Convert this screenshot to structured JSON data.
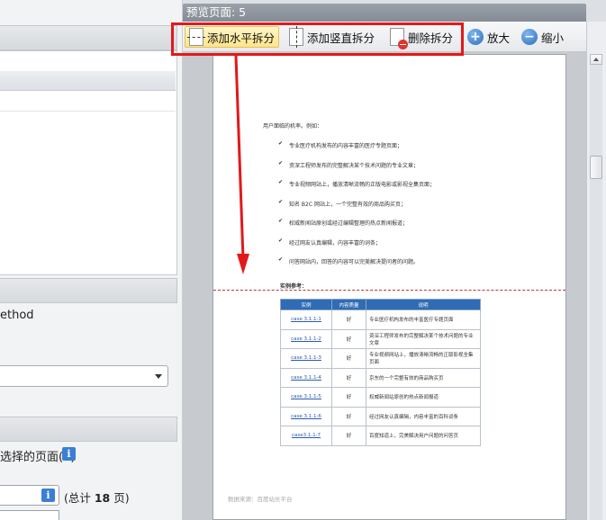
{
  "left": {
    "method_text": "ethod",
    "pages_label": "选择的页面(S)",
    "info_icon": "i",
    "total_prefix": "(总计 ",
    "total_pages": "18",
    "total_suffix": " 页)"
  },
  "preview": {
    "title": "预览页面: 5"
  },
  "toolbar": {
    "add_horizontal": "添加水平拆分",
    "add_vertical": "添加竖直拆分",
    "delete_split": "删除拆分",
    "zoom_in": "放大",
    "zoom_out": "缩小",
    "zoom_in_icon": "plus-circle-icon",
    "zoom_out_icon": "minus-circle-icon"
  },
  "colors": {
    "highlight_box": "#e2191b",
    "table_header": "#2f6cb5",
    "link": "#2a5bb0"
  },
  "page": {
    "intro": "用户面临的机率。例如：",
    "bullets": [
      "专业医疗机构发布的内容丰富的医疗专题页面；",
      "资深工程师发布的完整解决某个技术问题的专业文章；",
      "专业视频网站上，播放清晰流畅的正版电影或影视全集页面；",
      "知名 B2C 网站上，一个完整有效的商品购买页；",
      "权威新闻站原创或经过编辑整理的热点新闻报道；",
      "经过网友认真编辑，内容丰富的词条；",
      "问答网站内，回答的内容可以完美解决提问者的问题。"
    ],
    "case_title": "实例参考：",
    "table_headers": [
      "实例",
      "内容质量",
      "说明"
    ],
    "table_rows": [
      [
        "case 3.1.1-1",
        "好",
        "专业医疗机构发布的丰富医疗专题页面"
      ],
      [
        "case 3.1.1-2",
        "好",
        "资深工程师发布的完整解决某个技术问题的专业文章"
      ],
      [
        "case 3.1.1-3",
        "好",
        "专业视频网站上，播放清晰流畅的正版影视全集页面"
      ],
      [
        "case 3.1.1-4",
        "好",
        "京东的一个完整有效的商品购买页"
      ],
      [
        "case 3.1.1-5",
        "好",
        "权威新闻站原创的热点新闻报道"
      ],
      [
        "case 3.1.1-6",
        "好",
        "经过网友认真编辑，内容丰富的百科词条"
      ],
      [
        "case3.1.1-7",
        "好",
        "百度知道上，完美解决用户问题的问答页"
      ]
    ],
    "source": "数据来源：百度站长平台"
  }
}
